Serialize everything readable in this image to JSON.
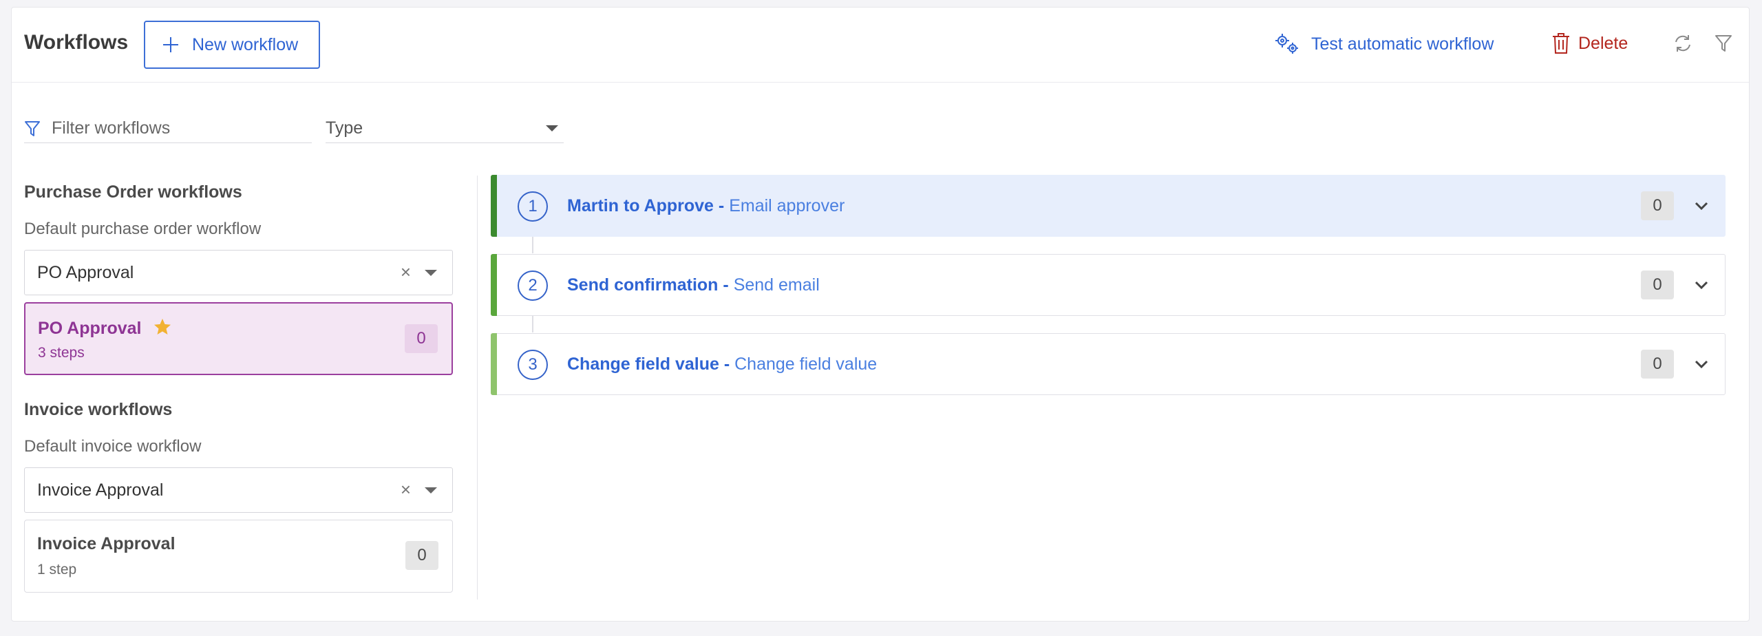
{
  "header": {
    "title": "Workflows",
    "new_workflow_label": "New workflow",
    "test_label": "Test automatic workflow",
    "delete_label": "Delete"
  },
  "filters": {
    "search_placeholder": "Filter workflows",
    "type_label": "Type"
  },
  "purchase_order": {
    "section_title": "Purchase Order workflows",
    "default_label": "Default purchase order workflow",
    "default_value": "PO Approval",
    "clear_symbol": "×",
    "workflow": {
      "name": "PO Approval",
      "steps": "3 steps",
      "count": "0",
      "starred": true
    }
  },
  "invoice": {
    "section_title": "Invoice workflows",
    "default_label": "Default invoice workflow",
    "default_value": "Invoice Approval",
    "clear_symbol": "×",
    "workflow": {
      "name": "Invoice Approval",
      "steps": "1 step",
      "count": "0",
      "starred": false
    }
  },
  "steps": [
    {
      "number": "1",
      "name": "Martin to Approve",
      "separator": " - ",
      "action": "Email approver",
      "count": "0",
      "bar_color": "#3b8a2f",
      "active": true
    },
    {
      "number": "2",
      "name": "Send confirmation",
      "separator": " - ",
      "action": "Send email",
      "count": "0",
      "bar_color": "#5aa73c",
      "active": false
    },
    {
      "number": "3",
      "name": "Change field value",
      "separator": " - ",
      "action": "Change field value",
      "count": "0",
      "bar_color": "#8fc46c",
      "active": false
    }
  ],
  "colors": {
    "accent": "#2f64d3",
    "danger": "#b3261e",
    "selected_purple": "#8e3594",
    "star": "#f2b233"
  }
}
